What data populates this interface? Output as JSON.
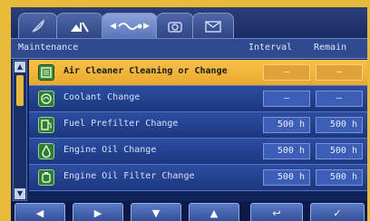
{
  "tabs": [
    {
      "icon": "feather-icon",
      "active": false
    },
    {
      "icon": "tools-icon",
      "active": false
    },
    {
      "icon": "maintenance-icon",
      "active": true
    },
    {
      "icon": "camera-icon",
      "active": false
    },
    {
      "icon": "mail-icon",
      "active": false
    }
  ],
  "header": {
    "title": "Maintenance",
    "interval": "Interval",
    "remain": "Remain"
  },
  "rows": [
    {
      "label": "Air Cleaner Cleaning or Change",
      "interval": "—",
      "remain": "—",
      "selected": true,
      "icon": "air-filter-icon"
    },
    {
      "label": "Coolant Change",
      "interval": "—",
      "remain": "—",
      "selected": false,
      "icon": "coolant-icon"
    },
    {
      "label": "Fuel Prefilter Change",
      "interval": "500 h",
      "remain": "500 h",
      "selected": false,
      "icon": "fuel-pump-icon"
    },
    {
      "label": "Engine Oil Change",
      "interval": "500 h",
      "remain": "500 h",
      "selected": false,
      "icon": "oil-drop-icon"
    },
    {
      "label": "Engine Oil Filter Change",
      "interval": "500 h",
      "remain": "500 h",
      "selected": false,
      "icon": "oil-filter-icon"
    }
  ],
  "buttons": [
    {
      "name": "left-button",
      "glyph": "◀"
    },
    {
      "name": "right-button",
      "glyph": "▶"
    },
    {
      "name": "down-button",
      "glyph": "▼"
    },
    {
      "name": "up-button",
      "glyph": "▲"
    },
    {
      "name": "back-button",
      "glyph": "↩"
    },
    {
      "name": "confirm-button",
      "glyph": "✓"
    }
  ],
  "colors": {
    "background": "#e8b93a",
    "screen": "#10225a",
    "row": "#2d4da0",
    "selected_row": "#f7c14a"
  }
}
